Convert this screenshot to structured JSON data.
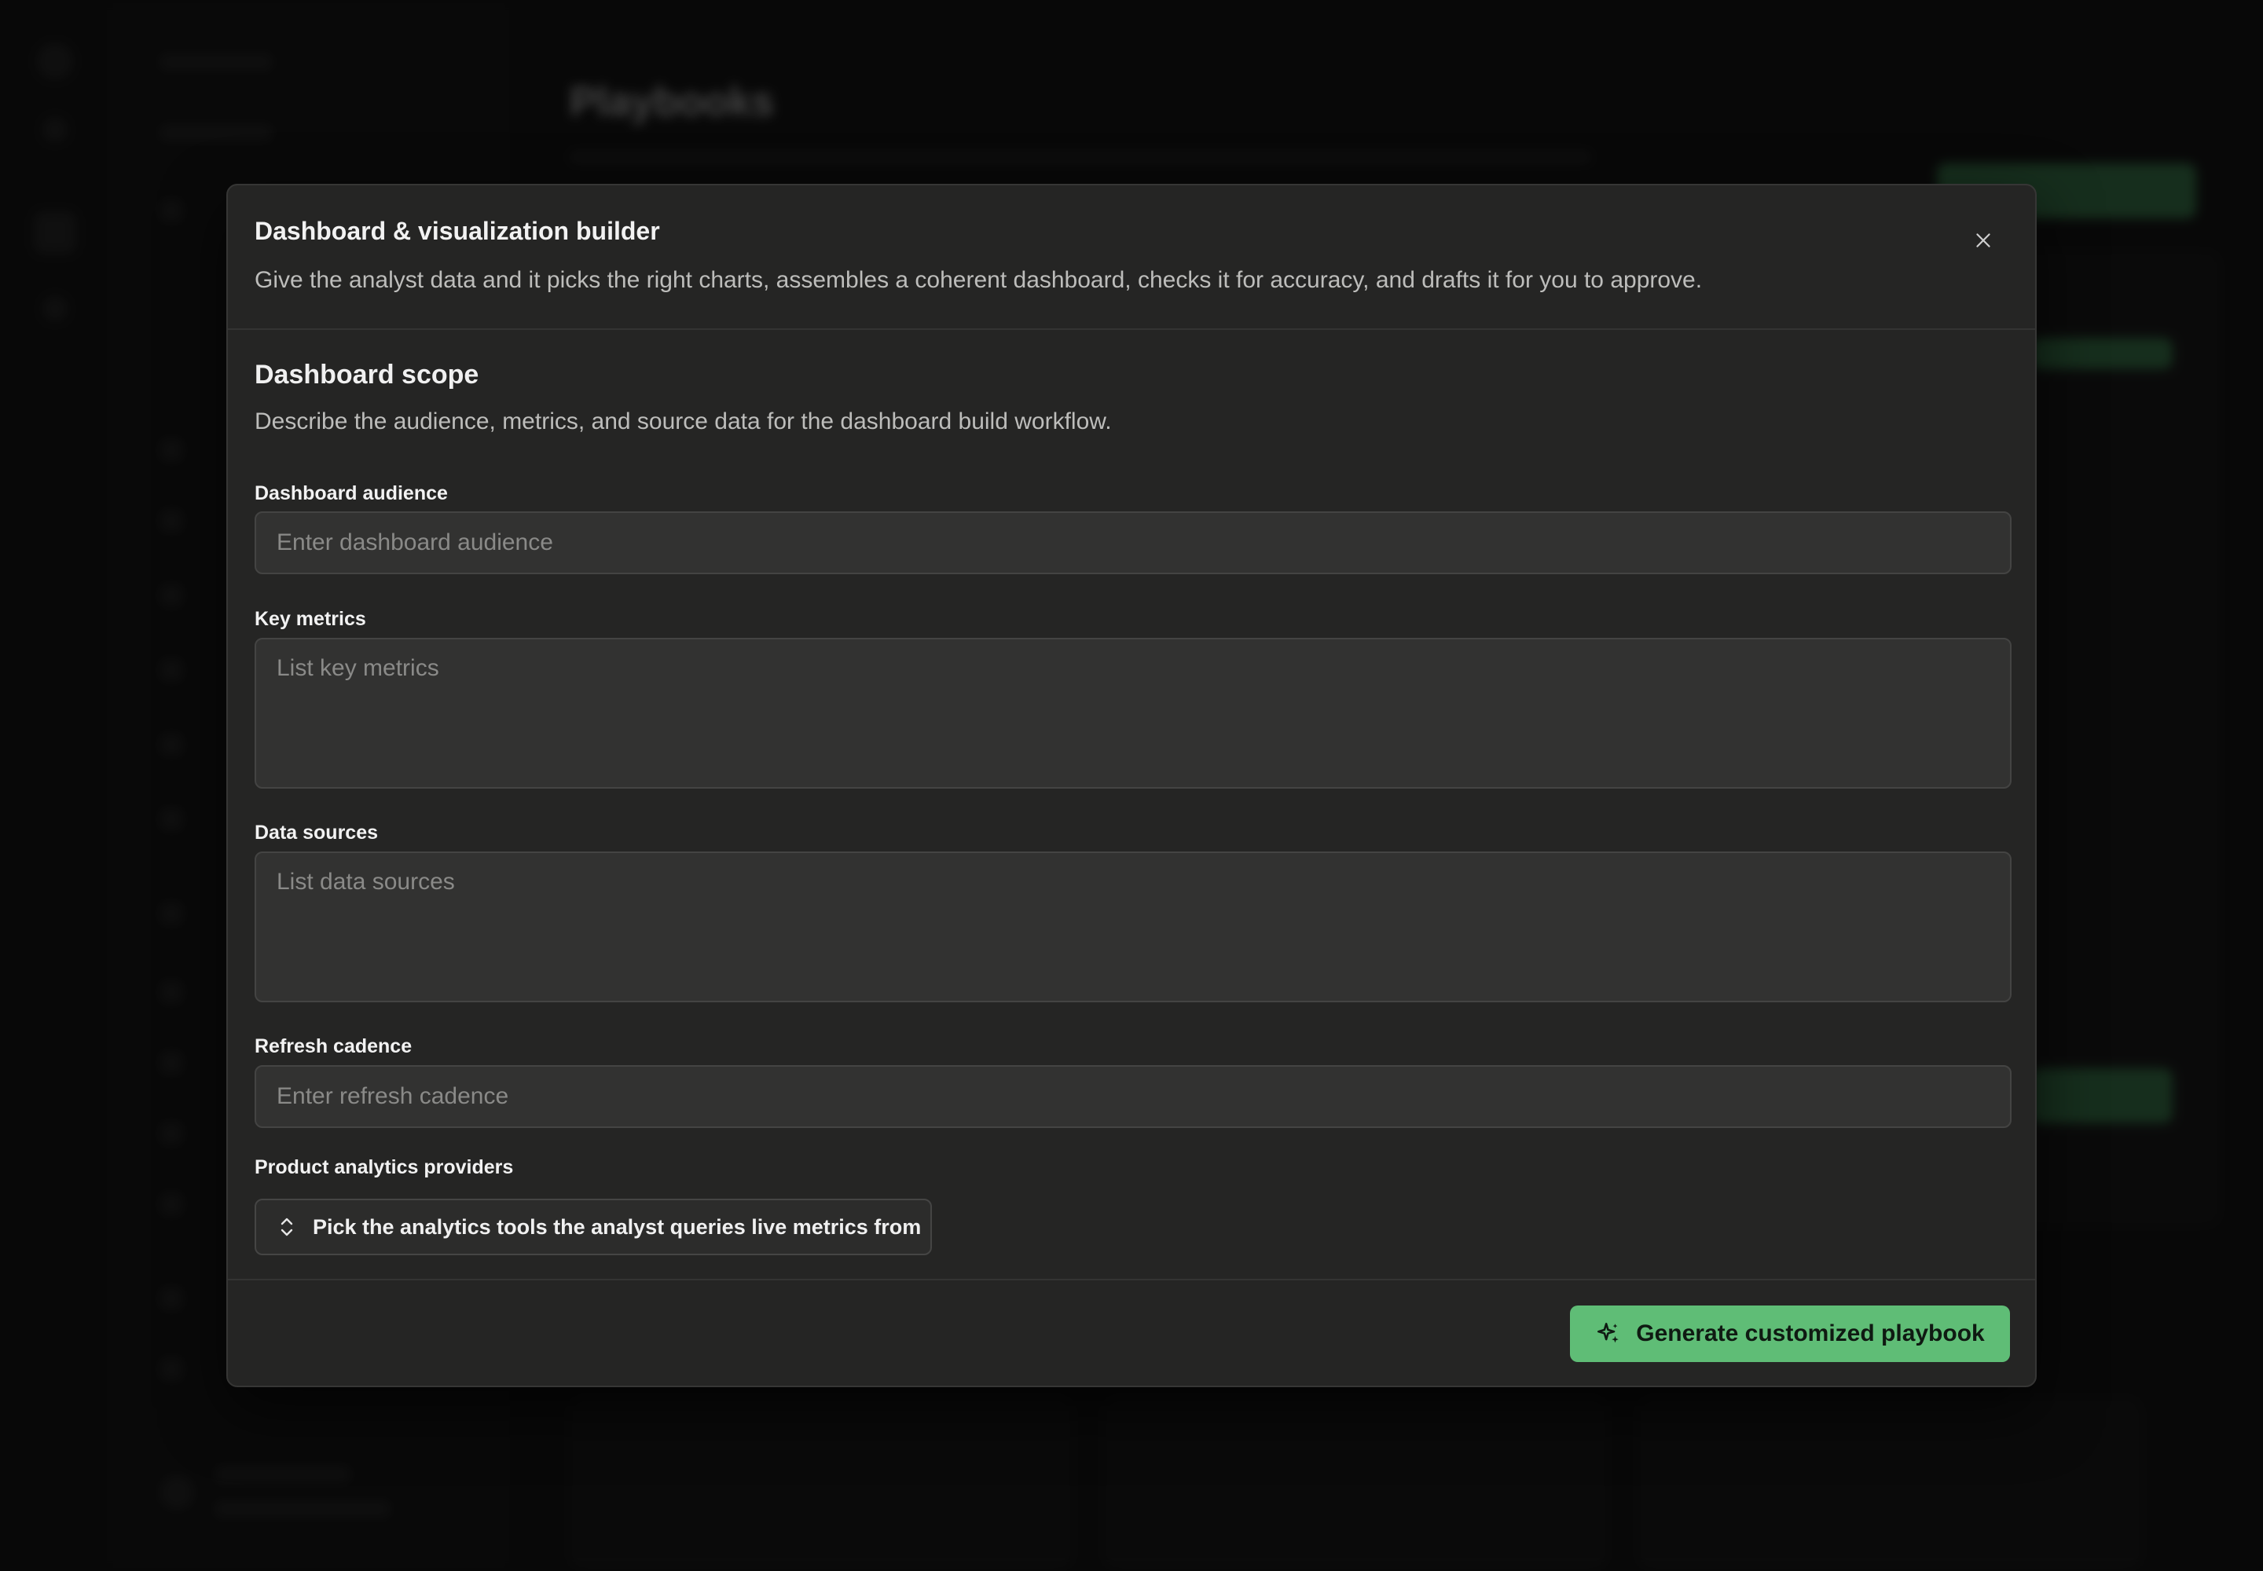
{
  "background": {
    "page_title": "Playbooks"
  },
  "modal": {
    "title": "Dashboard & visualization builder",
    "description": "Give the analyst data and it picks the right charts, assembles a coherent dashboard, checks it for accuracy, and drafts it for you to approve.",
    "close_icon": "close-icon",
    "section": {
      "title": "Dashboard scope",
      "description": "Describe the audience, metrics, and source data for the dashboard build workflow."
    },
    "fields": {
      "audience": {
        "label": "Dashboard audience",
        "placeholder": "Enter dashboard audience",
        "value": ""
      },
      "metrics": {
        "label": "Key metrics",
        "placeholder": "List key metrics",
        "value": ""
      },
      "sources": {
        "label": "Data sources",
        "placeholder": "List data sources",
        "value": ""
      },
      "cadence": {
        "label": "Refresh cadence",
        "placeholder": "Enter refresh cadence",
        "value": ""
      }
    },
    "providers": {
      "label": "Product analytics providers",
      "picker_text": "Pick the analytics tools the analyst queries live metrics from",
      "picker_icon": "chevron-up-down-icon"
    },
    "footer": {
      "generate_label": "Generate customized playbook",
      "generate_icon": "sparkles-icon",
      "accent": "#5fbd76"
    }
  }
}
